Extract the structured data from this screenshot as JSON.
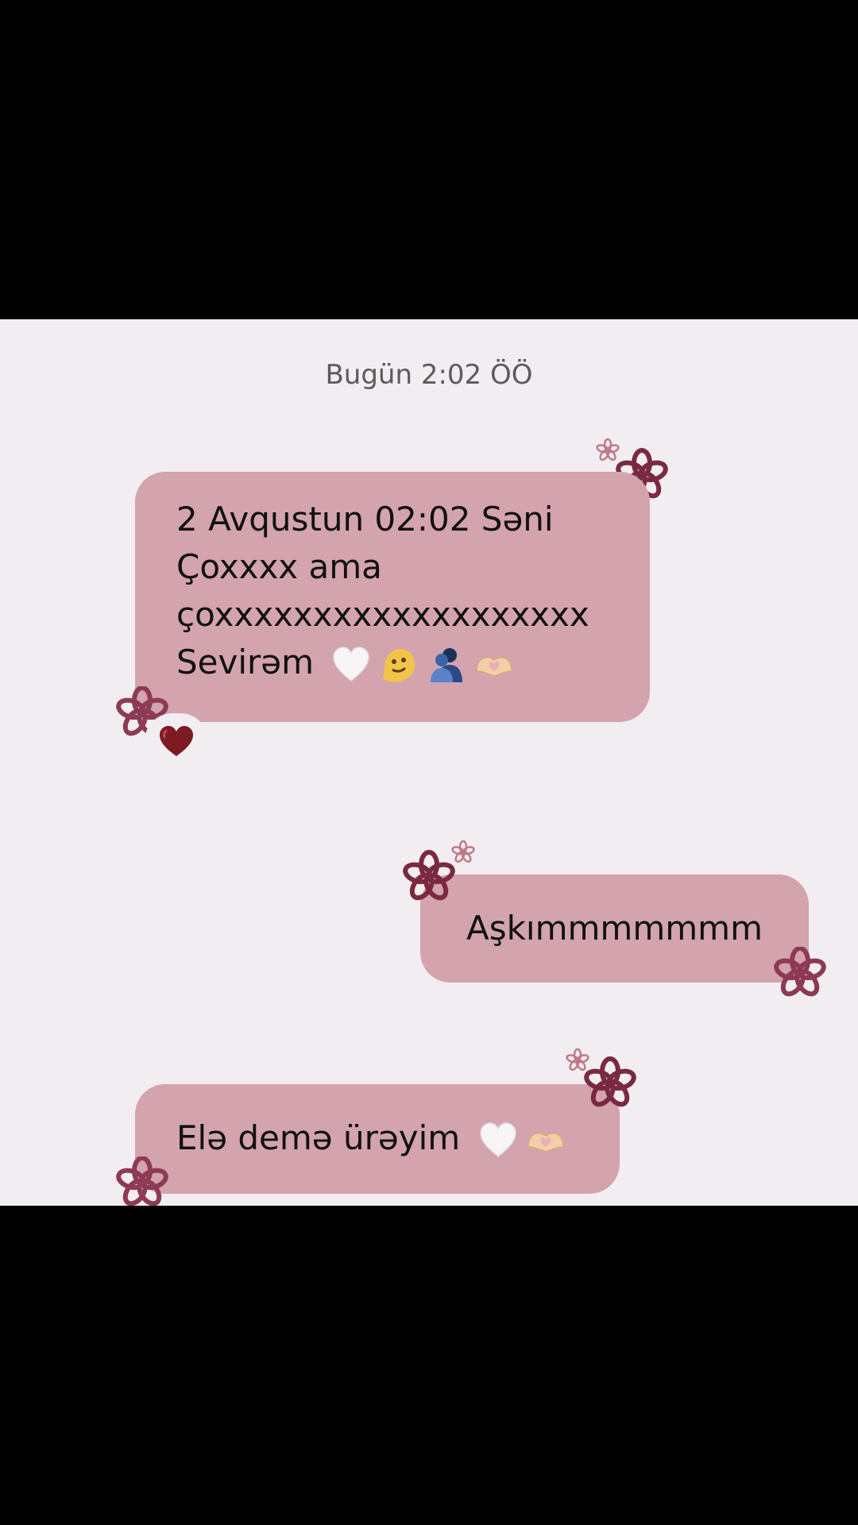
{
  "conversation": {
    "timestamp": "Bugün 2:02 ÖÖ",
    "messages": [
      {
        "lines": [
          "2 Avqustun 02:02 Səni",
          "Çoxxxx ama",
          "çoxxxxxxxxxxxxxxxxxxx",
          "Sevirəm"
        ],
        "emojis": [
          "white-heart",
          "melting-face",
          "people-hugging",
          "heart-hands"
        ],
        "reaction": "red-heart"
      },
      {
        "text": "Aşkımmmmmmm"
      },
      {
        "text": "Elə demə ürəyim",
        "emojis": [
          "white-heart",
          "heart-hands"
        ]
      }
    ]
  },
  "colors": {
    "background": "#f2edf0",
    "bubble": "#d3a3ae",
    "flower_dark": "#7a2a40",
    "flower_light": "#c07a8a",
    "heart_red": "#7e1a22"
  }
}
